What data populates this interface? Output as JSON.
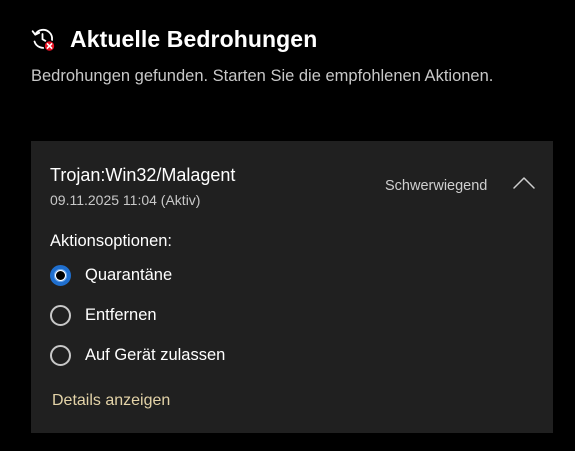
{
  "header": {
    "icon": "history-threat-icon",
    "title": "Aktuelle Bedrohungen",
    "subtitle": "Bedrohungen gefunden. Starten Sie die empfohlenen Aktionen."
  },
  "threat": {
    "name": "Trojan:Win32/Malagent",
    "date": "09.11.2025 11:04 (Aktiv)",
    "severity": "Schwerwiegend",
    "expanded": true,
    "actions_label": "Aktionsoptionen:",
    "options": [
      {
        "label": "Quarantäne",
        "selected": true
      },
      {
        "label": "Entfernen",
        "selected": false
      },
      {
        "label": "Auf Gerät zulassen",
        "selected": false
      }
    ],
    "details_link": "Details anzeigen"
  },
  "colors": {
    "background": "#000000",
    "card": "#202020",
    "accent": "#1f6fcf",
    "link": "#e3d3a8",
    "alert": "#e81123"
  }
}
